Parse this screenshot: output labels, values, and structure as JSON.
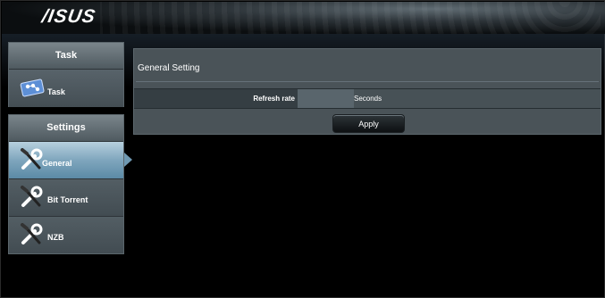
{
  "header": {
    "logo_text": "/ISUS"
  },
  "sidebar": {
    "task_panel": {
      "title": "Task",
      "item_label": "Task"
    },
    "settings_panel": {
      "title": "Settings",
      "items": [
        {
          "label": "General",
          "icon": "wrench-screwdriver-icon",
          "active": true
        },
        {
          "label": "Bit Torrent",
          "icon": "wrench-screwdriver-icon",
          "active": false
        },
        {
          "label": "NZB",
          "icon": "wrench-screwdriver-icon",
          "active": false
        }
      ]
    }
  },
  "main": {
    "title": "General Setting",
    "rows": [
      {
        "label": "Refresh rate",
        "value": "",
        "unit": "Seconds"
      }
    ],
    "apply_label": "Apply"
  },
  "colors": {
    "active_item": "#7fa6bd",
    "panel_bg": "#4a5459",
    "content_bg": "#4a5358",
    "button_bg": "#0d1012"
  }
}
